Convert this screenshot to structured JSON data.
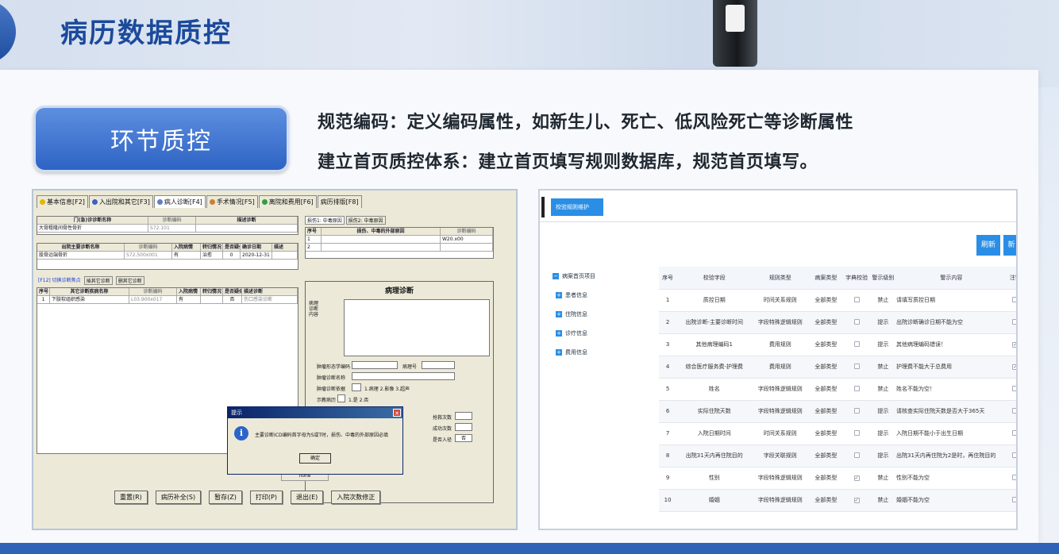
{
  "page": {
    "title": "病历数据质控",
    "badge": "环节质控",
    "desc1": "规范编码：定义编码属性，如新生儿、死亡、低风险死亡等诊断属性",
    "desc2": "建立首页质控体系：建立首页填写规则数据库，规范首页填写。"
  },
  "left_app": {
    "tabs": [
      "基本信息[F2]",
      "入出院和其它[F3]",
      "病人诊断[F4]",
      "手术情况[F5]",
      "离院和费用[F6]",
      "病历排版[F8]"
    ],
    "active_tab_index": 2,
    "grid1_headers": [
      "门(急)诊诊断名称",
      "诊断编码",
      "描述诊断"
    ],
    "grid1_row": [
      "大骨粗隆间骨性骨折",
      "S72.101"
    ],
    "grid2_headers": [
      "出院主要诊断名称",
      "诊断编码",
      "入院病情",
      "转归情况",
      "是否疑似",
      "确诊日期",
      "描述"
    ],
    "grid2_row": [
      "股骨远端骨折",
      "S72.500x001",
      "有",
      "治愈",
      "0",
      "2020-12-31"
    ],
    "switch_links": [
      "[F12] 切换诊断焦点",
      "插其它诊断",
      "删其它诊断"
    ],
    "grid3_headers": [
      "序号",
      "其它诊断疾病名称",
      "诊断编码",
      "入院病情",
      "转归情况",
      "是否疑似",
      "描述诊断"
    ],
    "grid3_row": [
      "1",
      "下肢软组织感染",
      "L03.900x017",
      "有",
      "",
      "否",
      "伤口感染诊断"
    ],
    "injury_tabs": [
      "损伤1: 中毒原因",
      "损伤2: 中毒原因"
    ],
    "injury_headers": [
      "序号",
      "损伤、中毒的外部原因",
      "诊断编码"
    ],
    "injury_rows": [
      [
        "1",
        "",
        "W20.x00"
      ],
      [
        "2",
        "",
        ""
      ]
    ],
    "pathology_title": "病理诊断",
    "pathology_label": "病理诊断内容",
    "tumor_fields": [
      "肿瘤形态学编码",
      "病理号",
      "肿瘤诊断名称",
      "肿瘤诊断依据"
    ],
    "tumor_basis": "1.病理 2.影像 3.超声",
    "tumor_extra": "示教病历",
    "tumor_extra_opts": "1.是 2.否",
    "rescue_labels": [
      "抢救次数",
      "成功次数",
      "是否入径"
    ],
    "rescue_value": "否",
    "dialog_title": "提示",
    "dialog_msg": "主要诊断ICD编码首字母为S或T时，损伤、中毒的外部原因必填",
    "dialog_ok": "确定",
    "none_label": "none",
    "buttons": [
      "重置(R)",
      "病历补全(S)",
      "暂存(Z)",
      "打印(P)",
      "退出(E)",
      "入院次数修正"
    ]
  },
  "right_app": {
    "tab_label": "校验规则维护",
    "btn_refresh": "刷新",
    "btn_partial": "新",
    "tree": [
      "病案首页项目",
      "患者信息",
      "住院信息",
      "诊疗信息",
      "费用信息"
    ],
    "columns": [
      "序号",
      "校验字段",
      "规则类型",
      "病案类型",
      "字典校验",
      "警示级别",
      "警示内容",
      "注销"
    ],
    "rows": [
      {
        "no": "1",
        "field": "质控日期",
        "rule": "时间关系规则",
        "type": "全部类型",
        "dict": false,
        "level": "禁止",
        "msg": "请填写质控日期",
        "cancel": false
      },
      {
        "no": "2",
        "field": "出院诊断-主要诊断时间",
        "rule": "字段特殊逻辑规则",
        "type": "全部类型",
        "dict": false,
        "level": "提示",
        "msg": "出院诊断确诊日期不能为空",
        "cancel": false
      },
      {
        "no": "3",
        "field": "其他病理编码1",
        "rule": "费用规则",
        "type": "全部类型",
        "dict": false,
        "level": "提示",
        "msg": "其他病理编码错误！",
        "cancel": true
      },
      {
        "no": "4",
        "field": "综合医疗服务费-护理费",
        "rule": "费用规则",
        "type": "全部类型",
        "dict": false,
        "level": "禁止",
        "msg": "护理费不能大于总费用",
        "cancel": true
      },
      {
        "no": "5",
        "field": "姓名",
        "rule": "字段特殊逻辑规则",
        "type": "全部类型",
        "dict": false,
        "level": "禁止",
        "msg": "姓名不能为空！",
        "cancel": false
      },
      {
        "no": "6",
        "field": "实际住院天数",
        "rule": "字段特殊逻辑规则",
        "type": "全部类型",
        "dict": false,
        "level": "提示",
        "msg": "请核查实际住院天数是否大于365天",
        "cancel": false
      },
      {
        "no": "7",
        "field": "入院日期时间",
        "rule": "时间关系规则",
        "type": "全部类型",
        "dict": false,
        "level": "提示",
        "msg": "入院日期不能小于出生日期",
        "cancel": false
      },
      {
        "no": "8",
        "field": "出院31天内再住院目的",
        "rule": "字段关联规则",
        "type": "全部类型",
        "dict": false,
        "level": "提示",
        "msg": "出院31天内再住院为2是时，再住院目的",
        "cancel": false
      },
      {
        "no": "9",
        "field": "性别",
        "rule": "字段特殊逻辑规则",
        "type": "全部类型",
        "dict": true,
        "level": "禁止",
        "msg": "性别不能为空",
        "cancel": false
      },
      {
        "no": "10",
        "field": "婚姻",
        "rule": "字段特殊逻辑规则",
        "type": "全部类型",
        "dict": true,
        "level": "禁止",
        "msg": "婚姻不能为空",
        "cancel": false
      }
    ]
  },
  "colors": {
    "title": "#1b4a9c",
    "badge": "#3a6fd0",
    "accent": "#2a8ee6"
  }
}
